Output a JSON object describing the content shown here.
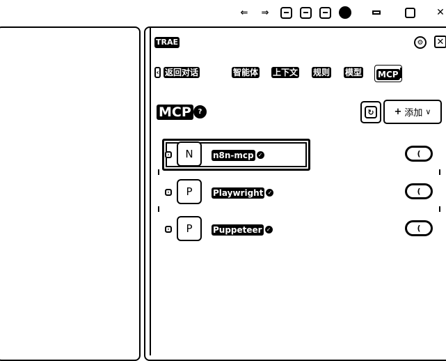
{
  "window": {
    "controls": [
      "arrow-left-icon",
      "arrow-right-icon",
      "layout-left-icon",
      "layout-center-icon",
      "layout-right-icon",
      "account-icon",
      "minimize-icon",
      "maximize-icon",
      "close-icon"
    ]
  },
  "panel": {
    "brand": "TRAE",
    "back_label": "返回对话",
    "tabs": [
      {
        "label": "智能体"
      },
      {
        "label": "上下文"
      },
      {
        "label": "规则"
      },
      {
        "label": "模型"
      },
      {
        "label": "MCP"
      }
    ],
    "active_tab": "MCP"
  },
  "mcp": {
    "title": "MCP",
    "add_label": "添加",
    "servers": [
      {
        "avatar": "N",
        "name": "n8n-mcp",
        "enabled": false,
        "selected": true
      },
      {
        "avatar": "P",
        "name": "Playwright",
        "enabled": false,
        "selected": false
      },
      {
        "avatar": "P",
        "name": "Puppeteer",
        "enabled": false,
        "selected": false
      }
    ]
  }
}
